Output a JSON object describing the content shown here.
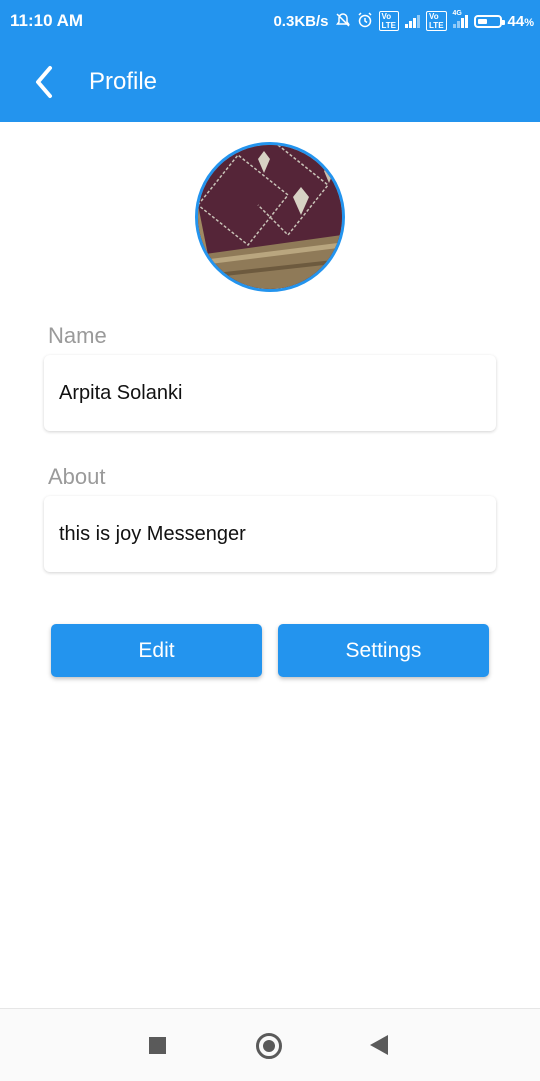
{
  "status_bar": {
    "time": "11:10 AM",
    "network_speed": "0.3KB/s",
    "battery_percent": "44",
    "battery_suffix": "%",
    "volte_label": "Vo\nLTE",
    "network_4g_label": "4G",
    "icons": [
      "mute-bell-icon",
      "alarm-icon",
      "volte-icon",
      "signal-icon",
      "volte-icon",
      "4g-signal-icon",
      "battery-icon"
    ],
    "battery_level": 0.44
  },
  "app_bar": {
    "title": "Profile",
    "back_icon": "chevron-left-icon",
    "color": "#2394ee"
  },
  "profile": {
    "name_label": "Name",
    "name_value": "Arpita Solanki",
    "about_label": "About",
    "about_value": "this is joy Messenger"
  },
  "buttons": {
    "edit_label": "Edit",
    "settings_label": "Settings"
  },
  "nav_bar": {
    "icons": [
      "recents-square-icon",
      "home-circle-icon",
      "back-triangle-icon"
    ]
  }
}
